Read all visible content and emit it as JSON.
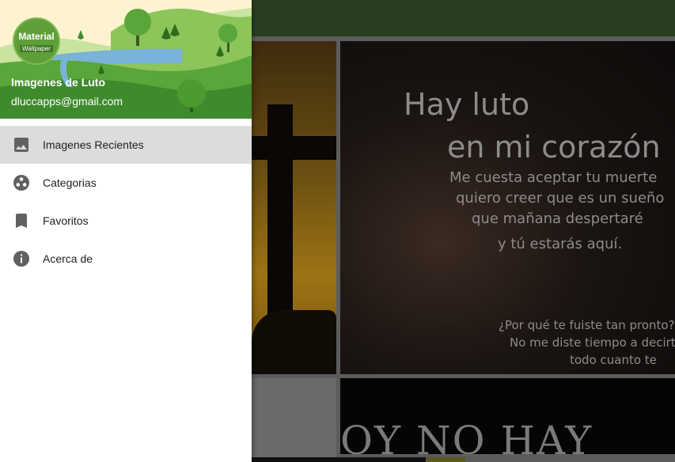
{
  "header": {
    "logo_line1": "Material",
    "logo_line2": "Wallpaper",
    "app_name": "Imagenes de Luto",
    "email": "dluccapps@gmail.com"
  },
  "menu": {
    "items": [
      {
        "label": "Imagenes Recientes",
        "icon": "image-icon",
        "active": true
      },
      {
        "label": "Categorias",
        "icon": "palette-icon",
        "active": false
      },
      {
        "label": "Favoritos",
        "icon": "bookmark-icon",
        "active": false
      },
      {
        "label": "Acerca de",
        "icon": "info-icon",
        "active": false
      }
    ]
  },
  "background": {
    "quote_lines": [
      "Hay luto",
      "en mi corazón",
      "Me cuesta aceptar tu muerte",
      "quiero creer que es un sueño",
      "que mañana despertaré",
      "y tú estarás aquí.",
      "¿Por qué te fuiste tan pronto?",
      "No me diste tiempo a decirte",
      "todo cuanto te"
    ],
    "bottom_text": "OY NO HAY"
  },
  "colors": {
    "toolbar": "#2a3f22",
    "active_item": "#dcdcdc",
    "header_green": "#3f8a2c"
  }
}
